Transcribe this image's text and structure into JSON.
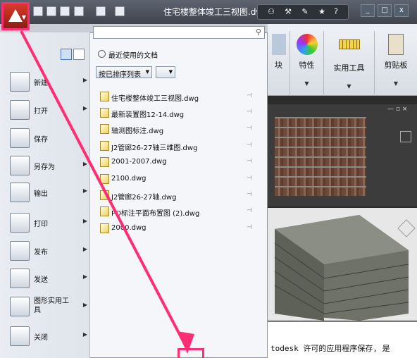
{
  "window": {
    "title": "住宅楼整体竣工三视图.dwg"
  },
  "quick_access": {
    "icons": [
      "new-icon",
      "open-icon",
      "save-icon",
      "undo-icon",
      "redo-icon",
      "plot-icon"
    ]
  },
  "search_group": {
    "icons": [
      "binoculars-icon",
      "wrench-icon",
      "pin-icon",
      "star-icon",
      "help-icon"
    ]
  },
  "window_controls": [
    "_",
    "□",
    "x"
  ],
  "ribbon": {
    "panels": [
      {
        "label": "块"
      },
      {
        "label": "特性"
      },
      {
        "label": "实用工具"
      },
      {
        "label": "剪贴板"
      }
    ]
  },
  "app_menu": {
    "search": {
      "value": "",
      "placeholder": ""
    },
    "items": [
      {
        "label": "新建"
      },
      {
        "label": "打开"
      },
      {
        "label": "保存"
      },
      {
        "label": "另存为"
      },
      {
        "label": "输出"
      },
      {
        "label": "打印"
      },
      {
        "label": "发布"
      },
      {
        "label": "发送"
      },
      {
        "label": "图形实用工\n具"
      },
      {
        "label": "关闭"
      }
    ],
    "recent": {
      "heading": "最近使用的文档",
      "sort_label": "按已排序列表",
      "files": [
        "住宅楼整体竣工三视图.dwg",
        "最新装置图12-14.dwg",
        "轴测图标注.dwg",
        "J2管廊26-27轴三维图.dwg",
        "2001-2007.dwg",
        "2100.dwg",
        "J2管廊26-27轴.dwg",
        "PO标注平面布置图 (2).dwg",
        "2000.dwg"
      ]
    }
  },
  "command_line": {
    "text": "todesk 许可的应用程序保存, 是"
  },
  "colors": {
    "highlight": "#ff2d73",
    "titlebar": "#4a5059"
  }
}
